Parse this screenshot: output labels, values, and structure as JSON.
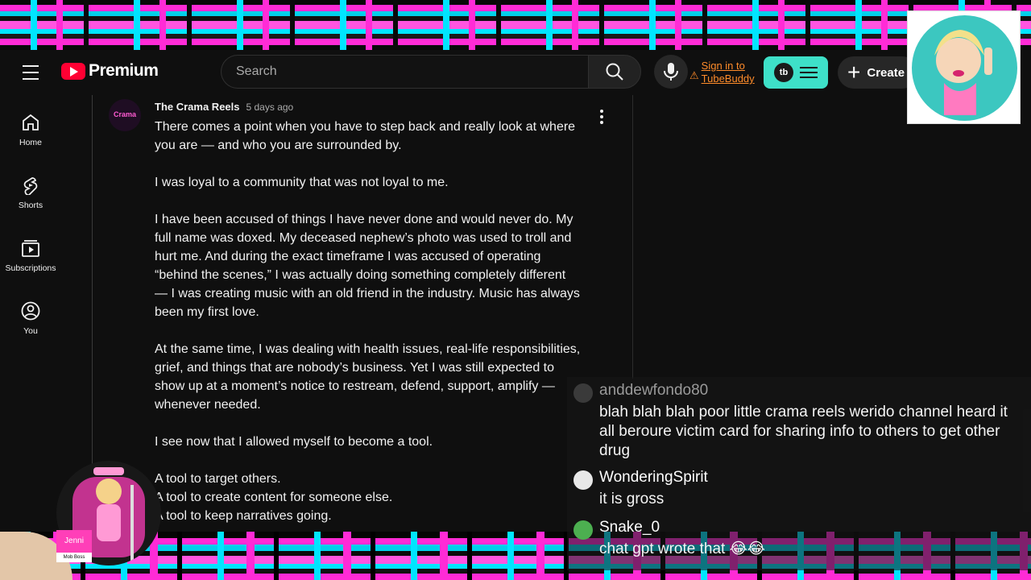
{
  "header": {
    "logo_text": "Premium",
    "search_placeholder": "Search",
    "signin_line1": "Sign in to",
    "signin_line2": "TubeBuddy",
    "tubebuddy_badge": "tb",
    "create_label": "Create"
  },
  "sidebar": {
    "items": [
      {
        "label": "Home",
        "icon": "home-icon"
      },
      {
        "label": "Shorts",
        "icon": "shorts-icon"
      },
      {
        "label": "Subscriptions",
        "icon": "subscriptions-icon"
      },
      {
        "label": "You",
        "icon": "you-icon"
      }
    ]
  },
  "comment": {
    "avatar_text": "Crama",
    "author": "The Crama Reels",
    "time": "5 days ago",
    "paragraphs": [
      "There comes a point when you have to step back and really look at where you are — and who you are surrounded by.",
      "I was loyal to a community that was not loyal to me.",
      "I have been accused of things I have never done and would never do. My full name was doxed. My deceased nephew’s photo was used to troll and hurt me. And during the exact timeframe I was accused of operating “behind the scenes,” I was actually doing something completely different — I was creating music with an old friend in the industry. Music has always been my first love.",
      "At the same time, I was dealing with health issues, real-life responsibilities, grief, and things that are nobody’s business. Yet I was still expected to show up at a moment’s notice to restream, defend, support, amplify — whenever needed.",
      "I see now that I allowed myself to become a tool.",
      "A tool to target others.",
      "A tool to create content for someone else.",
      "A tool to keep narratives going."
    ]
  },
  "chat": {
    "messages": [
      {
        "user": "anddewfondo80",
        "text": "blah blah blah poor little crama reels werido channel heard it all beroure victim card for sharing info to others to get other drug",
        "name_color": "#9a9a9a",
        "avatar_color": "#3a3a3a"
      },
      {
        "user": "WonderingSpirit",
        "text": "it is gross",
        "name_color": "#ffffff",
        "avatar_color": "#e8e8e8"
      },
      {
        "user": "Snake_0",
        "text": "chat gpt wrote that 😂😂",
        "name_color": "#ffffff",
        "avatar_color": "#4caf50"
      }
    ]
  },
  "overlay": {
    "char_name": "Jenni",
    "char_title": "Mob Boss"
  },
  "colors": {
    "accent_red": "#ff0033",
    "tubebuddy": "#3ee0c8",
    "signin_orange": "#ff8c2a",
    "plaid_pink": "#ff2bd6",
    "plaid_cyan": "#00e5ff"
  }
}
